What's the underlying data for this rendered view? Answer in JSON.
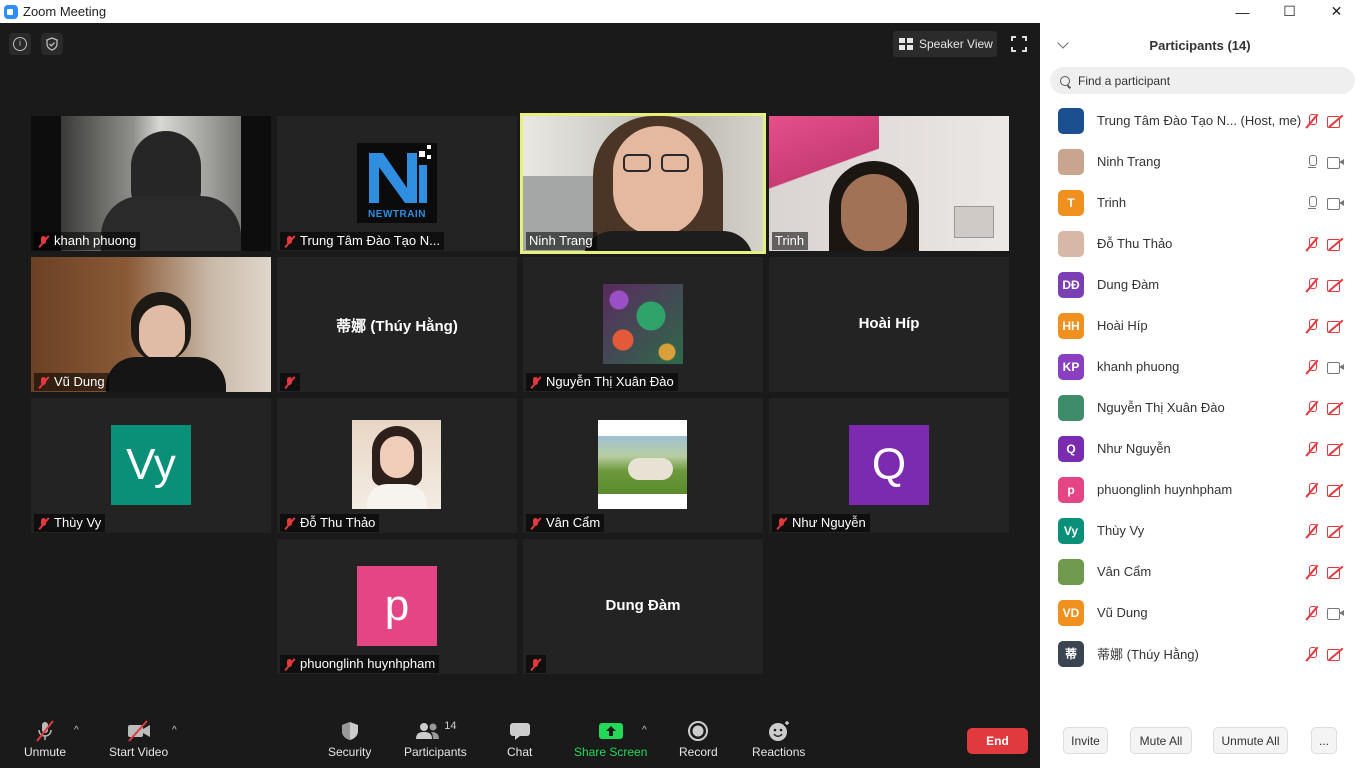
{
  "window": {
    "title": "Zoom Meeting",
    "min": "—",
    "max": "☐",
    "close": "✕"
  },
  "view": {
    "speaker_view_label": "Speaker View"
  },
  "tiles": [
    {
      "name": "khanh phuong"
    },
    {
      "name": "Trung Tâm Đào Tạo N..."
    },
    {
      "name": "Ninh Trang"
    },
    {
      "name": "Trinh"
    },
    {
      "name": "Vũ Dung"
    },
    {
      "center_name": "蒂娜 (Thúy Hằng)"
    },
    {
      "name": "Nguyễn Thị Xuân Đào"
    },
    {
      "center_name": "Hoài Híp"
    },
    {
      "name": "Thùy Vy",
      "avatar_text": "Vy",
      "color": "#0a8f78"
    },
    {
      "name": "Đỗ Thu Thảo"
    },
    {
      "name": "Vân Cẩm"
    },
    {
      "name": "Như Nguyễn",
      "avatar_text": "Q",
      "color": "#7b2bb0"
    },
    {
      "name": "phuonglinh huynhpham",
      "avatar_text": "p",
      "color": "#e64585"
    },
    {
      "center_name": "Dung Đàm"
    }
  ],
  "logo": {
    "brand": "NEWTRAIN"
  },
  "toolbar": {
    "unmute": "Unmute",
    "start_video": "Start Video",
    "security": "Security",
    "participants": "Participants",
    "participants_count": "14",
    "chat": "Chat",
    "share_screen": "Share Screen",
    "record": "Record",
    "reactions": "Reactions",
    "end": "End"
  },
  "panel": {
    "title": "Participants (14)",
    "search_placeholder": "Find a participant",
    "participants": [
      {
        "name": "Trung Tâm Đào Tạo N... (Host, me)",
        "initials": "",
        "color": "#1b4f8f",
        "mic": "muted",
        "cam": "off"
      },
      {
        "name": "Ninh Trang",
        "initials": "",
        "color": "#c9a48e",
        "mic": "on",
        "cam": "on"
      },
      {
        "name": "Trinh",
        "initials": "T",
        "color": "#f0901e",
        "mic": "on",
        "cam": "on"
      },
      {
        "name": "Đỗ Thu Thảo",
        "initials": "",
        "color": "#d7b7a5",
        "mic": "muted",
        "cam": "off"
      },
      {
        "name": "Dung Đàm",
        "initials": "DĐ",
        "color": "#7b3fb5",
        "mic": "muted",
        "cam": "off"
      },
      {
        "name": "Hoài Híp",
        "initials": "HH",
        "color": "#f0901e",
        "mic": "muted",
        "cam": "off"
      },
      {
        "name": "khanh phuong",
        "initials": "KP",
        "color": "#8a3fc0",
        "mic": "muted",
        "cam": "on"
      },
      {
        "name": "Nguyễn Thị Xuân Đào",
        "initials": "",
        "color": "#3f8c6b",
        "mic": "muted",
        "cam": "off"
      },
      {
        "name": "Như Nguyễn",
        "initials": "Q",
        "color": "#7b2bb0",
        "mic": "muted",
        "cam": "off"
      },
      {
        "name": "phuonglinh huynhpham",
        "initials": "p",
        "color": "#e64585",
        "mic": "muted",
        "cam": "off"
      },
      {
        "name": "Thùy Vy",
        "initials": "Vy",
        "color": "#0a8f78",
        "mic": "muted",
        "cam": "off"
      },
      {
        "name": "Vân Cẩm",
        "initials": "",
        "color": "#6f9a4e",
        "mic": "muted",
        "cam": "off"
      },
      {
        "name": "Vũ Dung",
        "initials": "VD",
        "color": "#f0901e",
        "mic": "muted",
        "cam": "on"
      },
      {
        "name": "蒂娜 (Thúy Hằng)",
        "initials": "蒂",
        "color": "#3b4552",
        "mic": "muted",
        "cam": "off"
      }
    ],
    "invite": "Invite",
    "mute_all": "Mute All",
    "unmute_all": "Unmute All",
    "more": "..."
  }
}
